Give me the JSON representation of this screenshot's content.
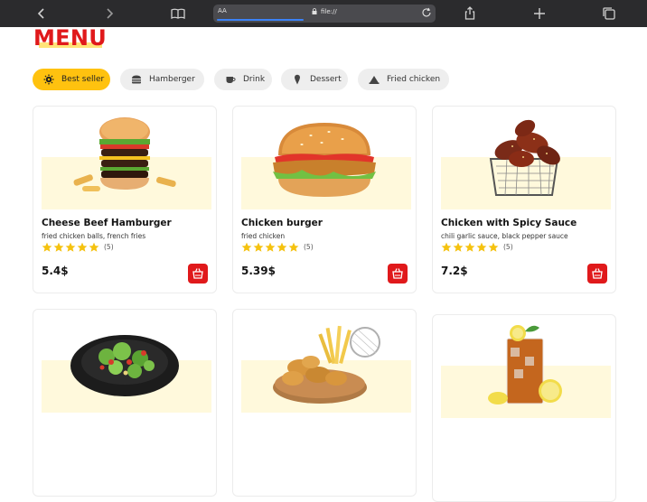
{
  "browser": {
    "url": "file://",
    "aa_label": "AA"
  },
  "page": {
    "title": "MENU"
  },
  "filters": [
    {
      "label": "Best seller",
      "icon": "gear-icon",
      "active": true
    },
    {
      "label": "Hamberger",
      "icon": "burger-icon",
      "active": false
    },
    {
      "label": "Drink",
      "icon": "cup-icon",
      "active": false
    },
    {
      "label": "Dessert",
      "icon": "ice-cream-icon",
      "active": false
    },
    {
      "label": "Fried chicken",
      "icon": "chicken-icon",
      "active": false
    }
  ],
  "products": [
    {
      "name": "Cheese Beef Hamburger",
      "desc": "fried chicken balls, french fries",
      "rating": 5,
      "reviews": "(5)",
      "price": "5.4$",
      "image": "cheese-beef-hamburger"
    },
    {
      "name": "Chicken burger",
      "desc": "fried chicken",
      "rating": 5,
      "reviews": "(5)",
      "price": "5.39$",
      "image": "chicken-burger"
    },
    {
      "name": "Chicken with Spicy Sauce",
      "desc": "chili garlic sauce, black pepper sauce",
      "rating": 5,
      "reviews": "(5)",
      "price": "7.2$",
      "image": "spicy-chicken-wings"
    },
    {
      "name": "",
      "desc": "",
      "rating": 0,
      "reviews": "",
      "price": "",
      "image": "salad-bowl"
    },
    {
      "name": "",
      "desc": "",
      "rating": 0,
      "reviews": "",
      "price": "",
      "image": "fried-chicken-fries"
    },
    {
      "name": "",
      "desc": "",
      "rating": 0,
      "reviews": "",
      "price": "",
      "image": "iced-tea-lemon"
    }
  ],
  "colors": {
    "accent": "#e0191b",
    "highlight": "#ffc20f",
    "band": "#fff9dc"
  }
}
